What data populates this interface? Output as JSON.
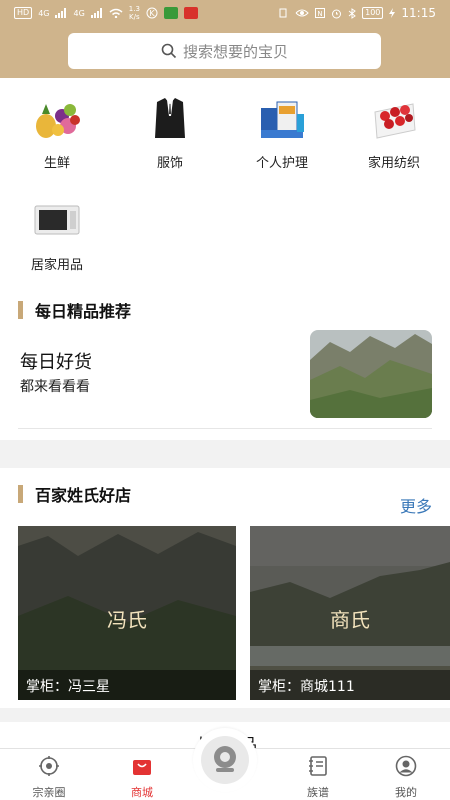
{
  "statusbar": {
    "network_chips": [
      "HD",
      "4G",
      "4G"
    ],
    "speed": "1.3\nK/s",
    "battery": "100",
    "time": "11:15"
  },
  "search": {
    "placeholder": "搜索想要的宝贝",
    "icon": "search-icon"
  },
  "categories": [
    {
      "label": "生鲜",
      "icon": "fresh-produce-image"
    },
    {
      "label": "服饰",
      "icon": "suit-image"
    },
    {
      "label": "个人护理",
      "icon": "personal-care-image"
    },
    {
      "label": "家用纺织",
      "icon": "home-textile-image"
    },
    {
      "label": "居家用品",
      "icon": "microwave-image"
    }
  ],
  "daily": {
    "section_title": "每日精品推荐",
    "title": "每日好货",
    "subtitle": "都来看看看"
  },
  "shops": {
    "section_title": "百家姓氏好店",
    "more_label": "更多",
    "items": [
      {
        "name": "冯氏",
        "owner": "掌柜：冯三星"
      },
      {
        "name": "商氏",
        "owner": "掌柜：商城111"
      }
    ]
  },
  "hot": {
    "title": "人气产品"
  },
  "tabbar": {
    "items": [
      {
        "label": "宗亲圈",
        "icon": "gear-icon"
      },
      {
        "label": "商城",
        "icon": "shopping-bag-icon"
      },
      {
        "label": "族谱",
        "icon": "notebook-icon"
      },
      {
        "label": "我的",
        "icon": "user-icon"
      }
    ],
    "center_icon": "camera-icon"
  },
  "colors": {
    "header": "#cfb48c",
    "accent_bar": "#c8a878",
    "more_link": "#3a78b8",
    "active_tab": "#e33333"
  }
}
